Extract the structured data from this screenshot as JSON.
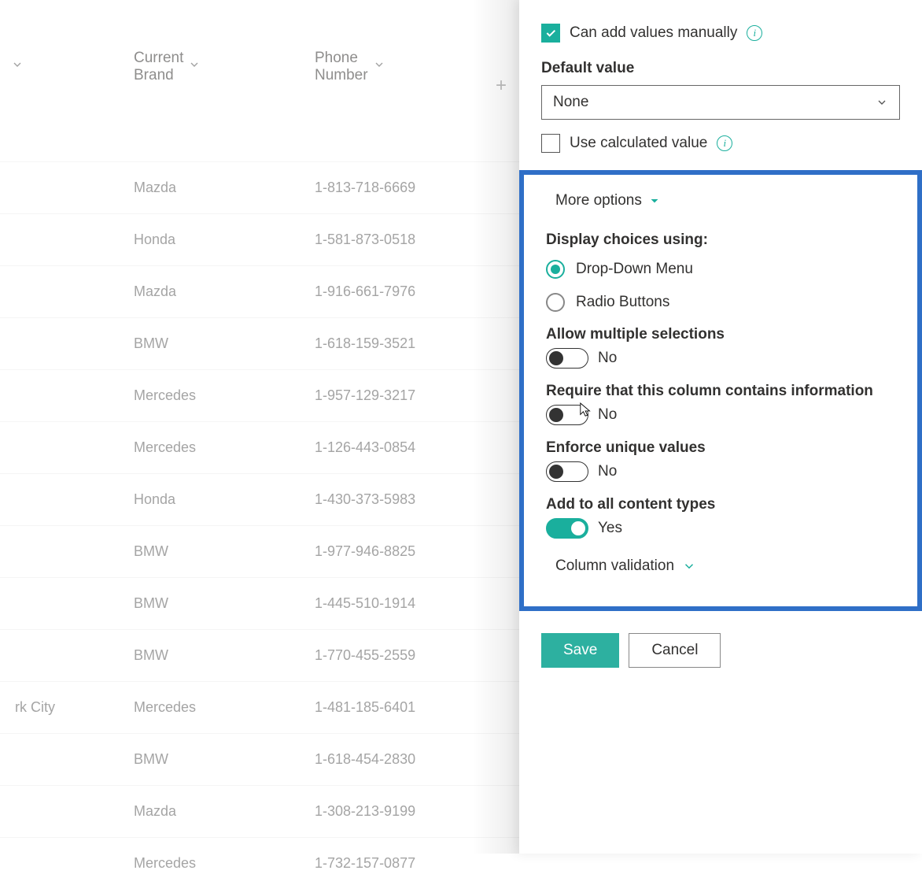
{
  "table": {
    "headers": {
      "col1_partial": "",
      "col2": "Current Brand",
      "col3": "Phone Number"
    },
    "rows": [
      {
        "c0": "",
        "brand": "Mazda",
        "phone": "1-813-718-6669"
      },
      {
        "c0": "",
        "brand": "Honda",
        "phone": "1-581-873-0518"
      },
      {
        "c0": "",
        "brand": "Mazda",
        "phone": "1-916-661-7976"
      },
      {
        "c0": "",
        "brand": "BMW",
        "phone": "1-618-159-3521"
      },
      {
        "c0": "",
        "brand": "Mercedes",
        "phone": "1-957-129-3217"
      },
      {
        "c0": "",
        "brand": "Mercedes",
        "phone": "1-126-443-0854"
      },
      {
        "c0": "",
        "brand": "Honda",
        "phone": "1-430-373-5983"
      },
      {
        "c0": "",
        "brand": "BMW",
        "phone": "1-977-946-8825"
      },
      {
        "c0": "",
        "brand": "BMW",
        "phone": "1-445-510-1914"
      },
      {
        "c0": "",
        "brand": "BMW",
        "phone": "1-770-455-2559"
      },
      {
        "c0": "rk City",
        "brand": "Mercedes",
        "phone": "1-481-185-6401"
      },
      {
        "c0": "",
        "brand": "BMW",
        "phone": "1-618-454-2830"
      },
      {
        "c0": "",
        "brand": "Mazda",
        "phone": "1-308-213-9199"
      },
      {
        "c0": "",
        "brand": "Mercedes",
        "phone": "1-732-157-0877"
      }
    ]
  },
  "panel": {
    "can_add_manually": {
      "label": "Can add values manually",
      "checked": true
    },
    "default_value": {
      "label": "Default value",
      "selected": "None"
    },
    "use_calculated": {
      "label": "Use calculated value",
      "checked": false
    },
    "more_options": "More options",
    "display_choices": {
      "label": "Display choices using:",
      "options": {
        "dropdown": "Drop-Down Menu",
        "radio": "Radio Buttons"
      },
      "selected": "dropdown"
    },
    "allow_multiple": {
      "label": "Allow multiple selections",
      "value": false,
      "text": "No"
    },
    "require_info": {
      "label": "Require that this column contains information",
      "value": false,
      "text": "No"
    },
    "enforce_unique": {
      "label": "Enforce unique values",
      "value": false,
      "text": "No"
    },
    "add_all_types": {
      "label": "Add to all content types",
      "value": true,
      "text": "Yes"
    },
    "column_validation": "Column validation",
    "buttons": {
      "save": "Save",
      "cancel": "Cancel"
    }
  }
}
